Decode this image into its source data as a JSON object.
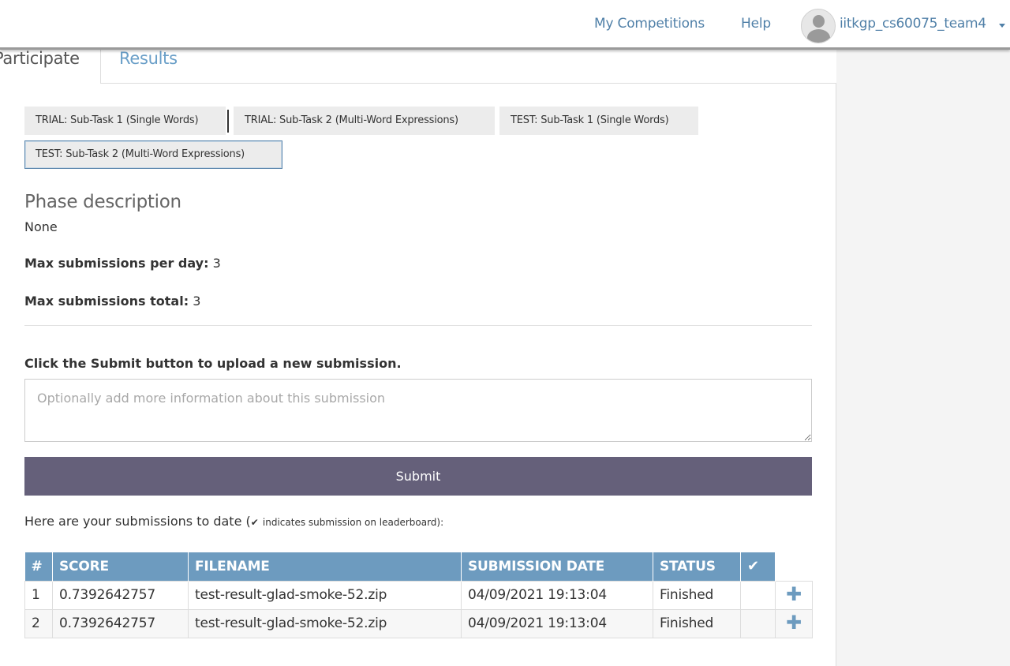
{
  "nav": {
    "my_competitions": "My Competitions",
    "help": "Help",
    "username": "iitkgp_cs60075_team4"
  },
  "tabs": {
    "participate": "Participate",
    "results": "Results"
  },
  "phases": [
    {
      "label": "TRIAL: Sub-Task 1 (Single Words)"
    },
    {
      "label": "TRIAL: Sub-Task 2 (Multi-Word Expressions)"
    },
    {
      "label": "TEST: Sub-Task 1 (Single Words)"
    },
    {
      "label": "TEST: Sub-Task 2 (Multi-Word Expressions)",
      "active": true
    }
  ],
  "phase_info": {
    "title": "Phase description",
    "description": "None",
    "max_per_day_label": "Max submissions per day:",
    "max_per_day": "3",
    "max_total_label": "Max submissions total:",
    "max_total": "3"
  },
  "submission_form": {
    "instruction": "Click the Submit button to upload a new submission.",
    "placeholder": "Optionally add more information about this submission",
    "value": "",
    "submit_label": "Submit"
  },
  "submissions": {
    "intro": "Here are your submissions to date (",
    "note": "indicates submission on leaderboard",
    "outro": "):",
    "columns": [
      "#",
      "SCORE",
      "FILENAME",
      "SUBMISSION DATE",
      "STATUS"
    ],
    "rows": [
      {
        "index": "1",
        "score": "0.7392642757",
        "filename": "test-result-glad-smoke-52.zip",
        "date": "04/09/2021 19:13:04",
        "status": "Finished"
      },
      {
        "index": "2",
        "score": "0.7392642757",
        "filename": "test-result-glad-smoke-52.zip",
        "date": "04/09/2021 19:13:04",
        "status": "Finished"
      }
    ]
  },
  "icons": {
    "checkmark": "check-icon",
    "expand": "plus-icon",
    "user": "user-avatar-icon",
    "caret": "caret-down-icon"
  },
  "colors": {
    "link": "#5080a8",
    "submit_button": "#65607a",
    "table_header": "#6d9bbf",
    "active_phase_border": "#5c87ad"
  }
}
